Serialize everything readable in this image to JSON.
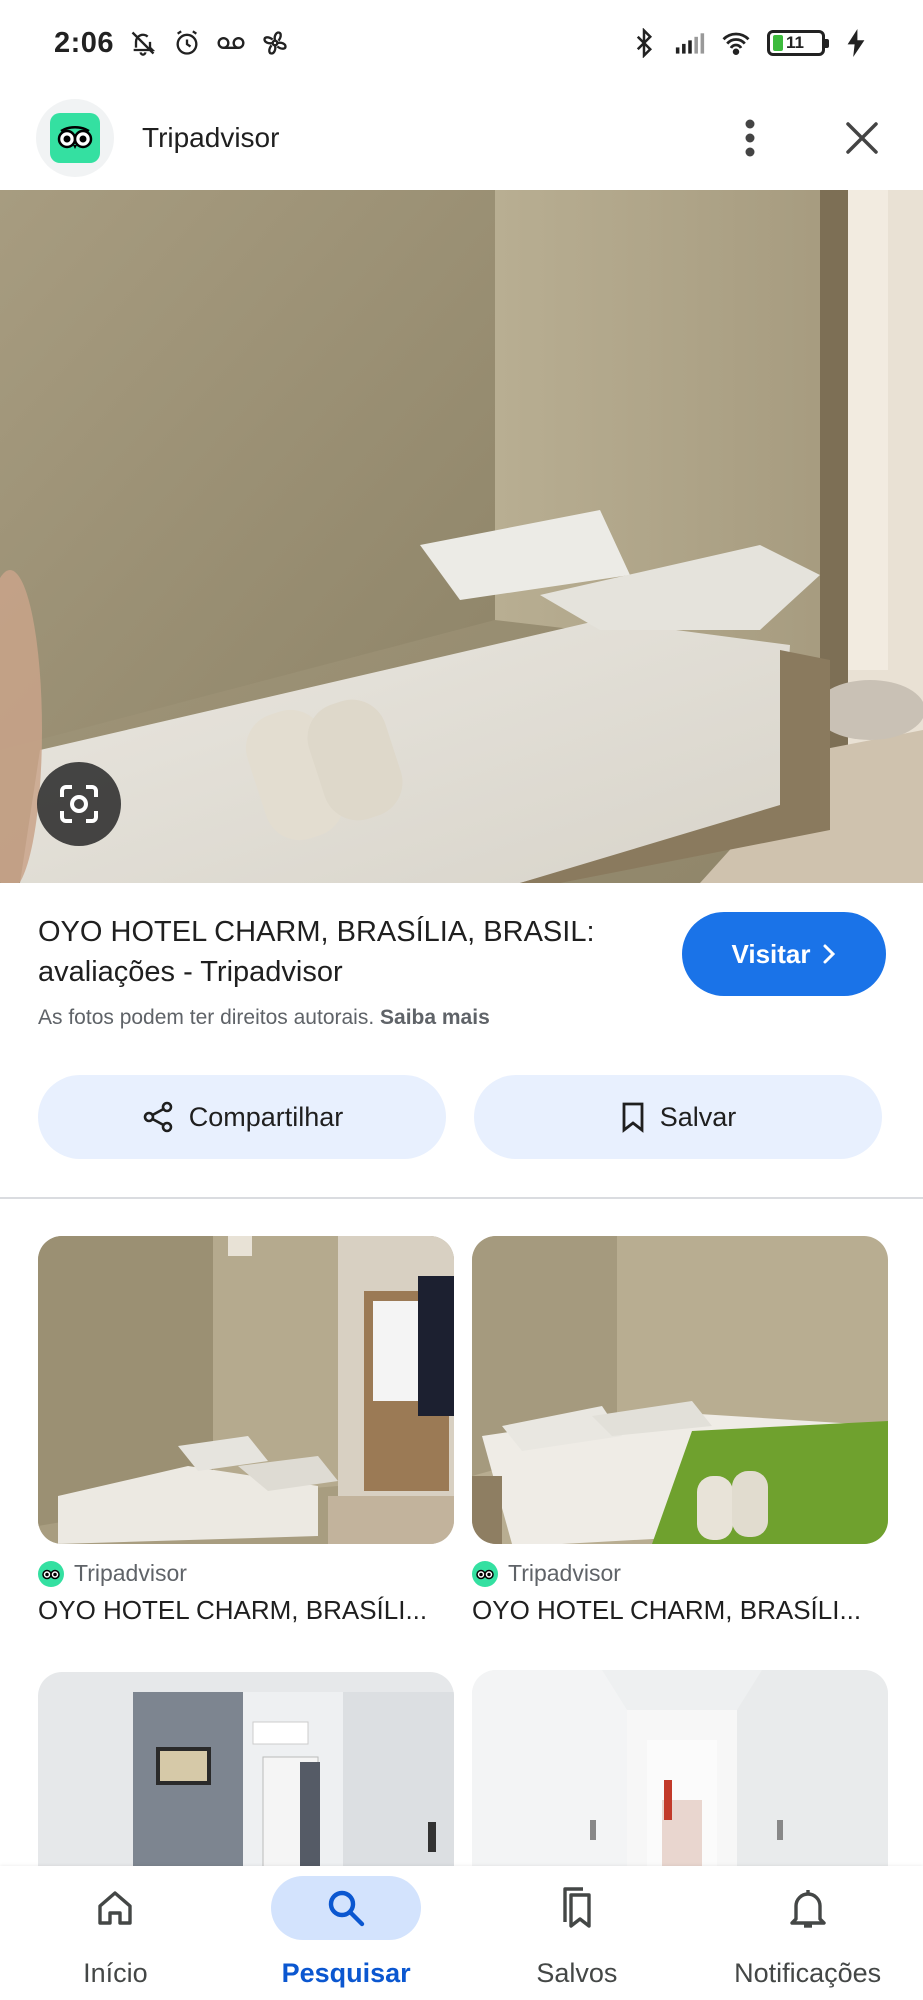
{
  "status_bar": {
    "time": "2:06",
    "battery": "11"
  },
  "header": {
    "site_name": "Tripadvisor",
    "logo_icon": "tripadvisor-owl-icon",
    "menu_icon": "more-vert-icon",
    "close_icon": "close-icon"
  },
  "result": {
    "title": "OYO HOTEL CHARM, BRASÍLIA, BRASIL: avaliações - Tripadvisor",
    "copyright_text": "As fotos podem ter direitos autorais.",
    "learn_more": "Saiba mais",
    "visit_label": "Visitar",
    "share_label": "Compartilhar",
    "save_label": "Salvar"
  },
  "related": [
    {
      "source": "Tripadvisor",
      "title": "OYO HOTEL CHARM, BRASÍLI..."
    },
    {
      "source": "Tripadvisor",
      "title": "OYO HOTEL CHARM, BRASÍLI..."
    }
  ],
  "bottom_nav": [
    {
      "label": "Início",
      "icon": "home-icon"
    },
    {
      "label": "Pesquisar",
      "icon": "search-icon",
      "active": true
    },
    {
      "label": "Salvos",
      "icon": "bookmarks-icon"
    },
    {
      "label": "Notificações",
      "icon": "bell-icon"
    }
  ],
  "colors": {
    "accent": "#1a73e8",
    "pill_bg": "#e8f0fe",
    "active_nav_bg": "#d3e3fd",
    "tripadvisor_green": "#34e0a1"
  }
}
